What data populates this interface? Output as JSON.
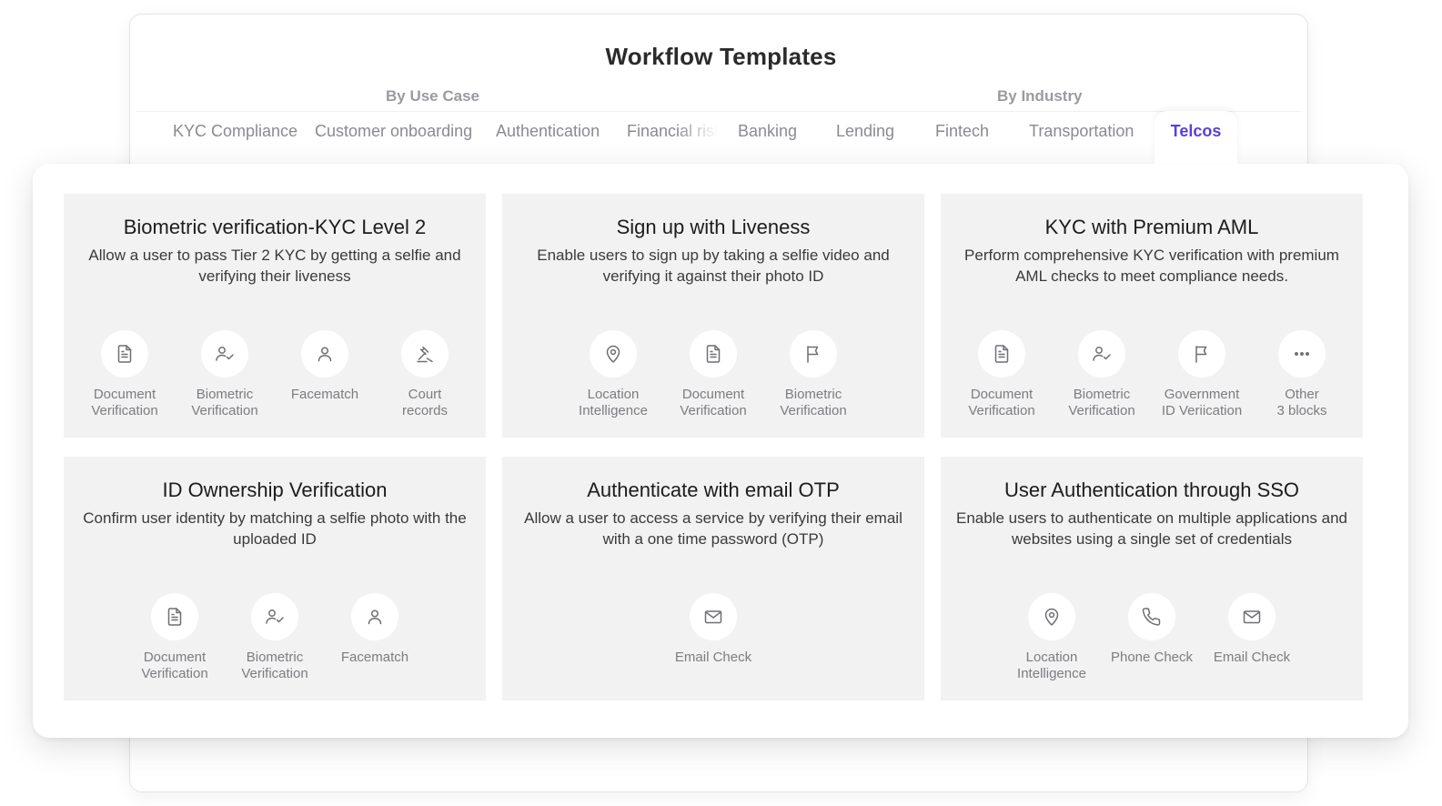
{
  "page": {
    "title": "Workflow Templates",
    "group_use_case": "By Use Case",
    "group_industry": "By Industry"
  },
  "tabs": [
    {
      "label": "KYC Compliance"
    },
    {
      "label": "Customer onboarding"
    },
    {
      "label": "Authentication"
    },
    {
      "label": "Financial risk"
    },
    {
      "label": "Banking"
    },
    {
      "label": "Lending"
    },
    {
      "label": "Fintech"
    },
    {
      "label": "Transportation"
    },
    {
      "label": "Telcos",
      "active": true
    }
  ],
  "colors": {
    "accent": "#5b3fd6",
    "card_bg": "#f2f2f2",
    "icon_stroke": "#6f6f74"
  },
  "cards": [
    {
      "title": "Biometric verification-KYC Level 2",
      "description": "Allow a user to pass Tier 2 KYC by getting a selfie and verifying their liveness",
      "blocks": [
        {
          "icon": "document-icon",
          "label": "Document\nVerification"
        },
        {
          "icon": "biometric-icon",
          "label": "Biometric\nVerification"
        },
        {
          "icon": "user-icon",
          "label": "Facematch"
        },
        {
          "icon": "gavel-icon",
          "label": "Court\nrecords"
        }
      ]
    },
    {
      "title": "Sign up with Liveness",
      "description": "Enable users to sign up by taking a selfie video and verifying it against their photo ID",
      "blocks": [
        {
          "icon": "location-icon",
          "label": "Location\nIntelligence"
        },
        {
          "icon": "document-icon",
          "label": "Document\nVerification"
        },
        {
          "icon": "flag-icon",
          "label": "Biometric\nVerification"
        }
      ]
    },
    {
      "title": "KYC with Premium AML",
      "description": "Perform comprehensive KYC verification with premium AML checks to meet compliance needs.",
      "blocks": [
        {
          "icon": "document-icon",
          "label": "Document\nVerification"
        },
        {
          "icon": "biometric-icon",
          "label": "Biometric\nVerification"
        },
        {
          "icon": "flag-icon",
          "label": "Government\nID Veriication"
        },
        {
          "icon": "more-icon",
          "label": "Other\n3 blocks"
        }
      ]
    },
    {
      "title": "ID Ownership Verification",
      "description": "Confirm user identity by matching a selfie photo with the uploaded ID",
      "blocks": [
        {
          "icon": "document-icon",
          "label": "Document\nVerification"
        },
        {
          "icon": "biometric-icon",
          "label": "Biometric\nVerification"
        },
        {
          "icon": "user-icon",
          "label": "Facematch"
        }
      ]
    },
    {
      "title": "Authenticate with email OTP",
      "description": "Allow a user to access a service by verifying their email with a one time password (OTP)",
      "blocks": [
        {
          "icon": "mail-icon",
          "label": "Email Check"
        }
      ]
    },
    {
      "title": "User Authentication through SSO",
      "description": "Enable users to authenticate on multiple applications and websites using a single set of credentials",
      "blocks": [
        {
          "icon": "location-icon",
          "label": "Location\nIntelligence"
        },
        {
          "icon": "phone-icon",
          "label": "Phone Check"
        },
        {
          "icon": "mail-icon",
          "label": "Email Check"
        }
      ]
    }
  ]
}
